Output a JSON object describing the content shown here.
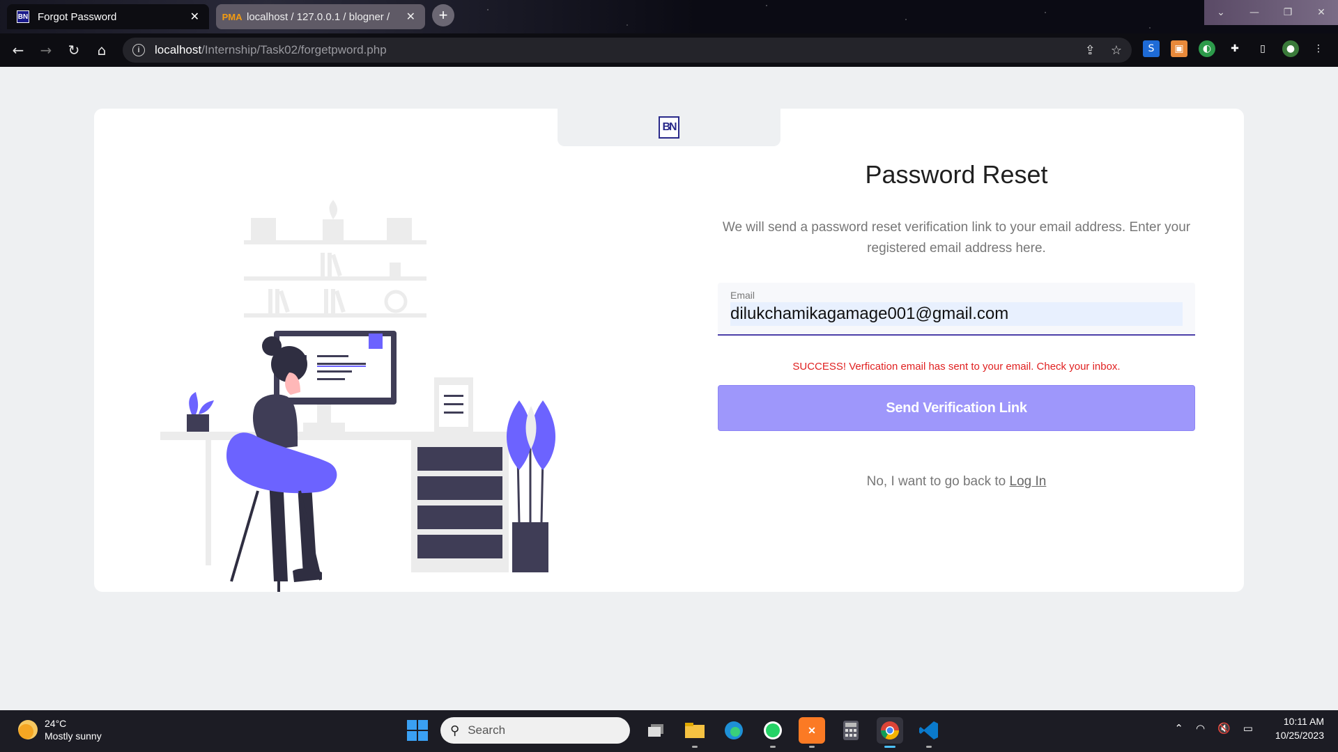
{
  "browser": {
    "tabs": [
      {
        "title": "Forgot Password",
        "favicon": "BN",
        "active": true
      },
      {
        "title": "localhost / 127.0.0.1 / blogner /",
        "favicon": "PMA",
        "active": false
      }
    ],
    "url_host": "localhost",
    "url_path": "/Internship/Task02/forgetpword.php",
    "window_controls": {
      "dropdown": "⌄",
      "minimize": "—",
      "restore": "❐",
      "close": "✕"
    }
  },
  "page": {
    "logo_text": "BN",
    "heading": "Password Reset",
    "description": "We will send a password reset verification link to your email address. Enter your registered email address here.",
    "email_label": "Email",
    "email_value": "dilukchamikagamage001@gmail.com",
    "success_message": "SUCCESS! Verfication email has sent to your email. Check your inbox.",
    "submit_button": "Send Verification Link",
    "back_text": "No, I want to go back to ",
    "login_link": "Log In",
    "colors": {
      "accent": "#9e97fb",
      "error": "#e02020",
      "illustration_accent": "#6c63ff"
    }
  },
  "taskbar": {
    "weather_temp": "24°C",
    "weather_desc": "Mostly sunny",
    "search_placeholder": "Search",
    "time": "10:11 AM",
    "date": "10/25/2023"
  }
}
